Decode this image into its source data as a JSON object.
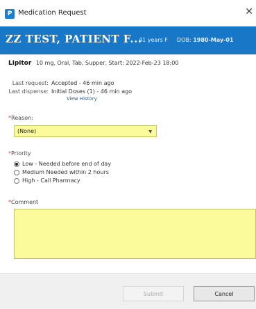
{
  "window": {
    "icon_letter": "P",
    "title": "Medication Request",
    "close_glyph": "✕"
  },
  "banner": {
    "patient_name": "ZZ TEST, PATIENT F...",
    "age_sex": "41 years  F",
    "dob_label": "DOB:",
    "dob_value": "1980-May-01"
  },
  "medication": {
    "name": "Lipitor",
    "details": "10 mg, Oral, Tab, Supper, Start: 2022-Feb-23 18:00"
  },
  "history": {
    "last_request_label": "Last request:",
    "last_request_value": "Accepted - 46 min ago",
    "last_dispense_label": "Last dispense:",
    "last_dispense_value": "Initial Doses (1) - 46 min ago",
    "view_history_link": "View History"
  },
  "reason": {
    "required_marker": "*",
    "label": "Reason:",
    "selected": "(None)",
    "arrow_icon": "▼"
  },
  "priority": {
    "required_marker": "*",
    "label": "Priority",
    "options": [
      {
        "label": "Low - Needed before end of day",
        "checked": true
      },
      {
        "label": "Medium Needed within 2 hours",
        "checked": false
      },
      {
        "label": "High - Call Pharmacy",
        "checked": false
      }
    ]
  },
  "comment": {
    "required_marker": "*",
    "label": "Comment",
    "value": ""
  },
  "buttons": {
    "submit": "Submit",
    "cancel": "Cancel"
  },
  "colors": {
    "banner_bg": "#1877c6",
    "required_field_bg": "#fbfb9c",
    "required_marker": "#d43c3c",
    "link": "#1a5ea8"
  }
}
